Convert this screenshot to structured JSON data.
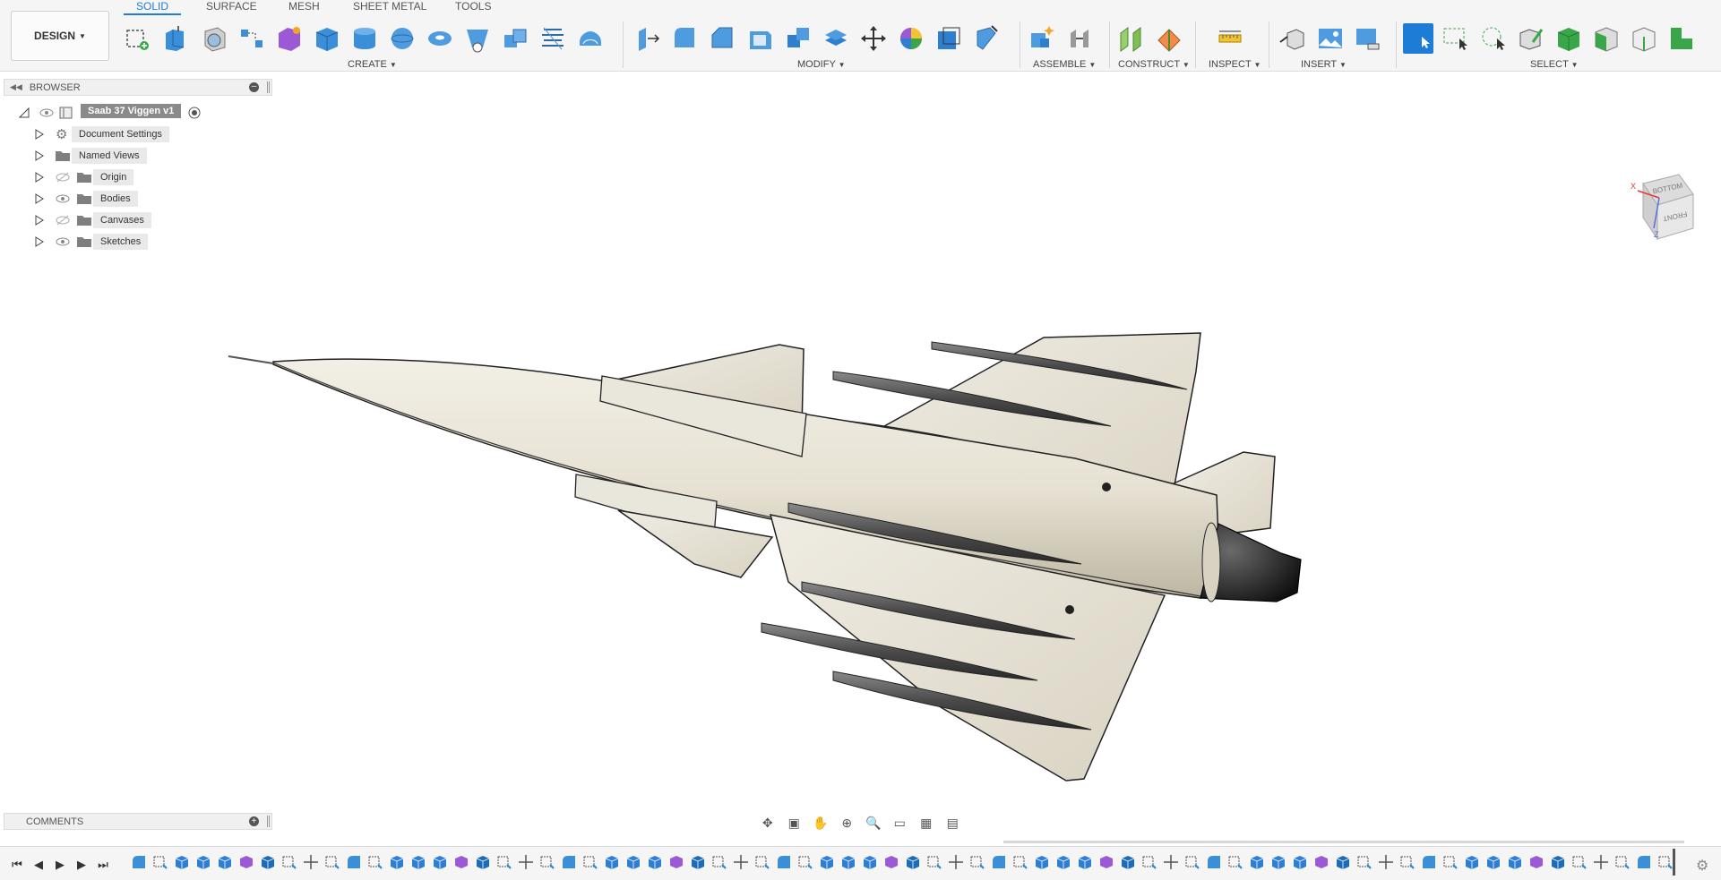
{
  "workspace": {
    "label": "DESIGN"
  },
  "tabs": [
    {
      "label": "SOLID",
      "active": true
    },
    {
      "label": "SURFACE",
      "active": false
    },
    {
      "label": "MESH",
      "active": false
    },
    {
      "label": "SHEET METAL",
      "active": false
    },
    {
      "label": "TOOLS",
      "active": false
    }
  ],
  "groups": {
    "create": "CREATE",
    "modify": "MODIFY",
    "assemble": "ASSEMBLE",
    "construct": "CONSTRUCT",
    "inspect": "INSPECT",
    "insert": "INSERT",
    "select": "SELECT"
  },
  "browser": {
    "title": "BROWSER",
    "root": "Saab 37 Viggen v1",
    "items": [
      {
        "label": "Document Settings",
        "icon": "gear-icon",
        "eye": "none"
      },
      {
        "label": "Named Views",
        "icon": "folder-icon",
        "eye": "none"
      },
      {
        "label": "Origin",
        "icon": "folder-icon",
        "eye": "hidden"
      },
      {
        "label": "Bodies",
        "icon": "folder-icon",
        "eye": "visible"
      },
      {
        "label": "Canvases",
        "icon": "folder-icon",
        "eye": "hidden"
      },
      {
        "label": "Sketches",
        "icon": "folder-icon",
        "eye": "visible"
      }
    ]
  },
  "viewcube": {
    "top_face": "BOTTOM",
    "front_face": "FRONT",
    "axis_x": "X",
    "axis_z": "Z"
  },
  "comments": {
    "title": "COMMENTS"
  },
  "colors": {
    "accent": "#1c7cd6",
    "body": "#e6e1d2",
    "nozzle": "#1a1a1a",
    "missile": "#555555"
  }
}
